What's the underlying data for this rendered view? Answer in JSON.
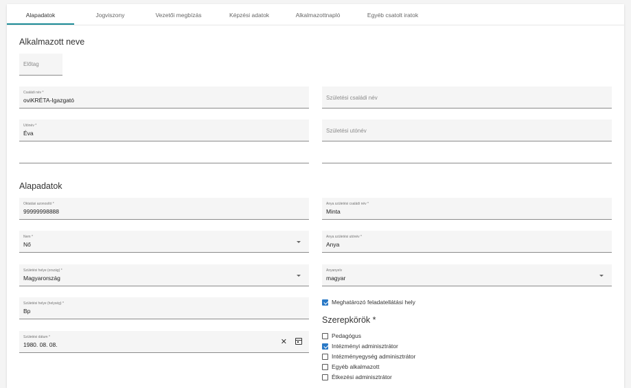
{
  "tabs": [
    {
      "label": "Alapadatok"
    },
    {
      "label": "Jogviszony"
    },
    {
      "label": "Vezetői megbízás"
    },
    {
      "label": "Képzési adatok"
    },
    {
      "label": "Alkalmazottnapló"
    },
    {
      "label": "Egyéb csatolt iratok"
    }
  ],
  "name_section": {
    "title": "Alkalmazott neve",
    "prefix_placeholder": "Előtag",
    "family_name": {
      "label": "Családi név *",
      "value": "oviKRÉTA-Igazgató"
    },
    "birth_family_name_placeholder": "Születési családi név",
    "given_name": {
      "label": "Utónév *",
      "value": "Éva"
    },
    "birth_given_name_placeholder": "Születési utónév"
  },
  "basic_section": {
    "title": "Alapadatok",
    "education_id": {
      "label": "Oktatási azonosító *",
      "value": "99999998888"
    },
    "gender": {
      "label": "Nem *",
      "value": "Nő"
    },
    "birth_country": {
      "label": "Születési helye (ország) *",
      "value": "Magyarország"
    },
    "birth_city": {
      "label": "Születési helye (helység) *",
      "value": "Bp"
    },
    "birth_date": {
      "label": "Születési dátum *",
      "value": "1980. 08. 08.",
      "clear_glyph": "✕"
    },
    "mother_family_name": {
      "label": "Anya születési családi név *",
      "value": "Minta"
    },
    "mother_given_name": {
      "label": "Anya születési utónév *",
      "value": "Anya"
    },
    "mother_tongue": {
      "label": "Anyanyelv",
      "value": "magyar"
    },
    "determining_site": {
      "label": "Meghatározó feladatellátási hely",
      "checked": true
    }
  },
  "roles_section": {
    "title": "Szerepkörök *",
    "roles": [
      {
        "label": "Pedagógus",
        "checked": false
      },
      {
        "label": "Intézményi adminisztrátor",
        "checked": true
      },
      {
        "label": "Intézményegység adminisztrátor",
        "checked": false
      },
      {
        "label": "Egyéb alkalmazott",
        "checked": false
      },
      {
        "label": "Étkezési adminisztrátor",
        "checked": false
      }
    ]
  },
  "colors": {
    "accent": "#1a8a96",
    "checkbox": "#2a79c6"
  }
}
